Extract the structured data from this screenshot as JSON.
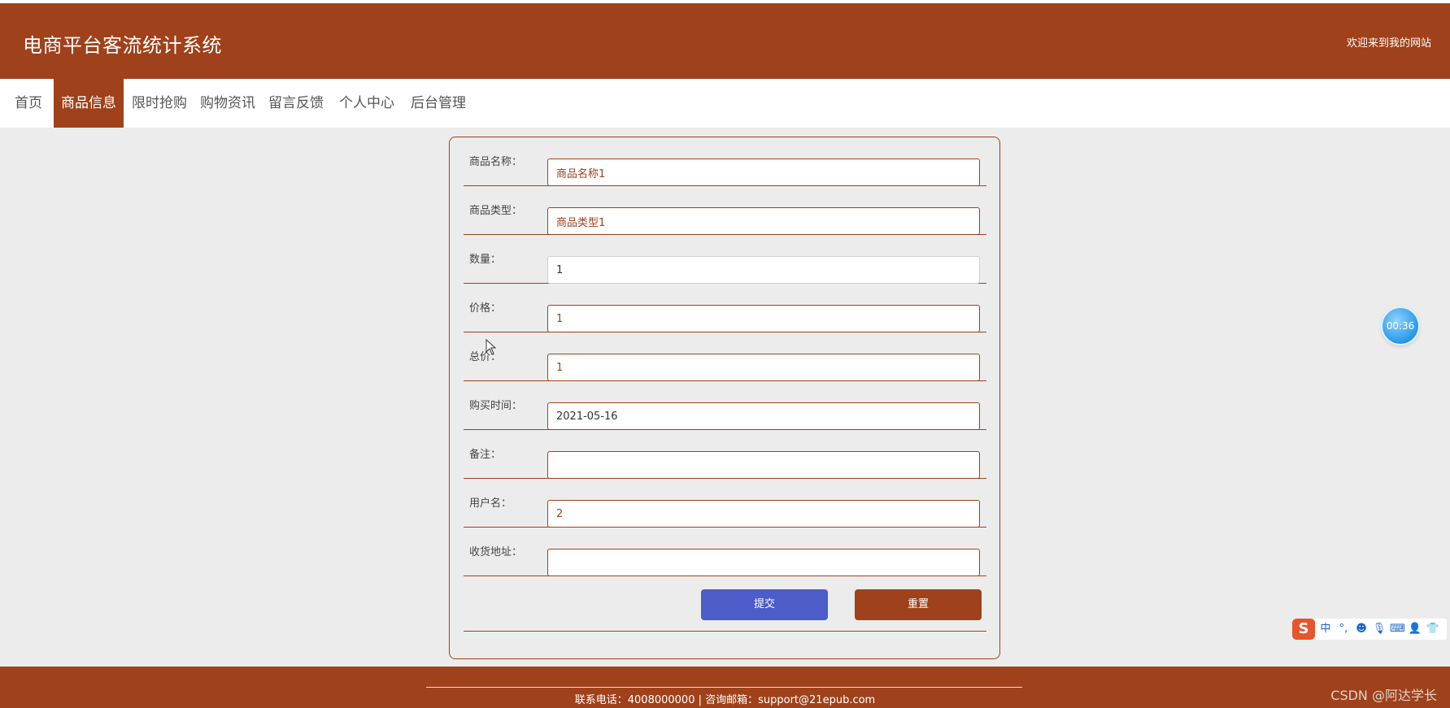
{
  "header": {
    "title": "电商平台客流统计系统",
    "welcome": "欢迎来到我的网站"
  },
  "nav": {
    "items": [
      "首页",
      "商品信息",
      "限时抢购",
      "购物资讯",
      "留言反馈",
      "个人中心",
      "后台管理"
    ],
    "active_index": 1
  },
  "form": {
    "fields": [
      {
        "label": "商品名称：",
        "value": "商品名称1"
      },
      {
        "label": "商品类型：",
        "value": "商品类型1"
      },
      {
        "label": "数量：",
        "value": "1"
      },
      {
        "label": "价格：",
        "value": "1"
      },
      {
        "label": "总价：",
        "value": "1"
      },
      {
        "label": "购买时间：",
        "value": "2021-05-16"
      },
      {
        "label": "备注：",
        "value": ""
      },
      {
        "label": "用户名：",
        "value": "2"
      },
      {
        "label": "收货地址：",
        "value": ""
      }
    ],
    "submit_label": "提交",
    "reset_label": "重置"
  },
  "footer": {
    "contact": "联系电话：4008000000 | 咨询邮箱：support@21epub.com"
  },
  "overlay": {
    "timer": "00:36",
    "ime_logo": "S",
    "ime_mode": "中",
    "watermark": "CSDN @阿达学长"
  },
  "colors": {
    "brand": "#9f411a",
    "submit": "#4c5cc8",
    "background": "#ececec"
  }
}
